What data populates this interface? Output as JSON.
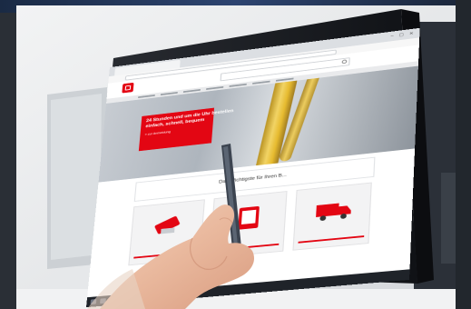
{
  "browser": {
    "tab_label": "",
    "url": ""
  },
  "hero": {
    "line1": "24 Stunden und um die Uhr bestellen",
    "line2": "einfach, schnell, bequem",
    "line3": "» zur Anmeldung"
  },
  "section": {
    "title": "Das Wichtigste für Ihren B..."
  },
  "colors": {
    "brand_red": "#e30613",
    "oil_yellow": "#f4d35a"
  },
  "icons": {
    "window_controls": "minimize-maximize-close-icons",
    "logo": "brand-logo",
    "search": "search-icon"
  }
}
